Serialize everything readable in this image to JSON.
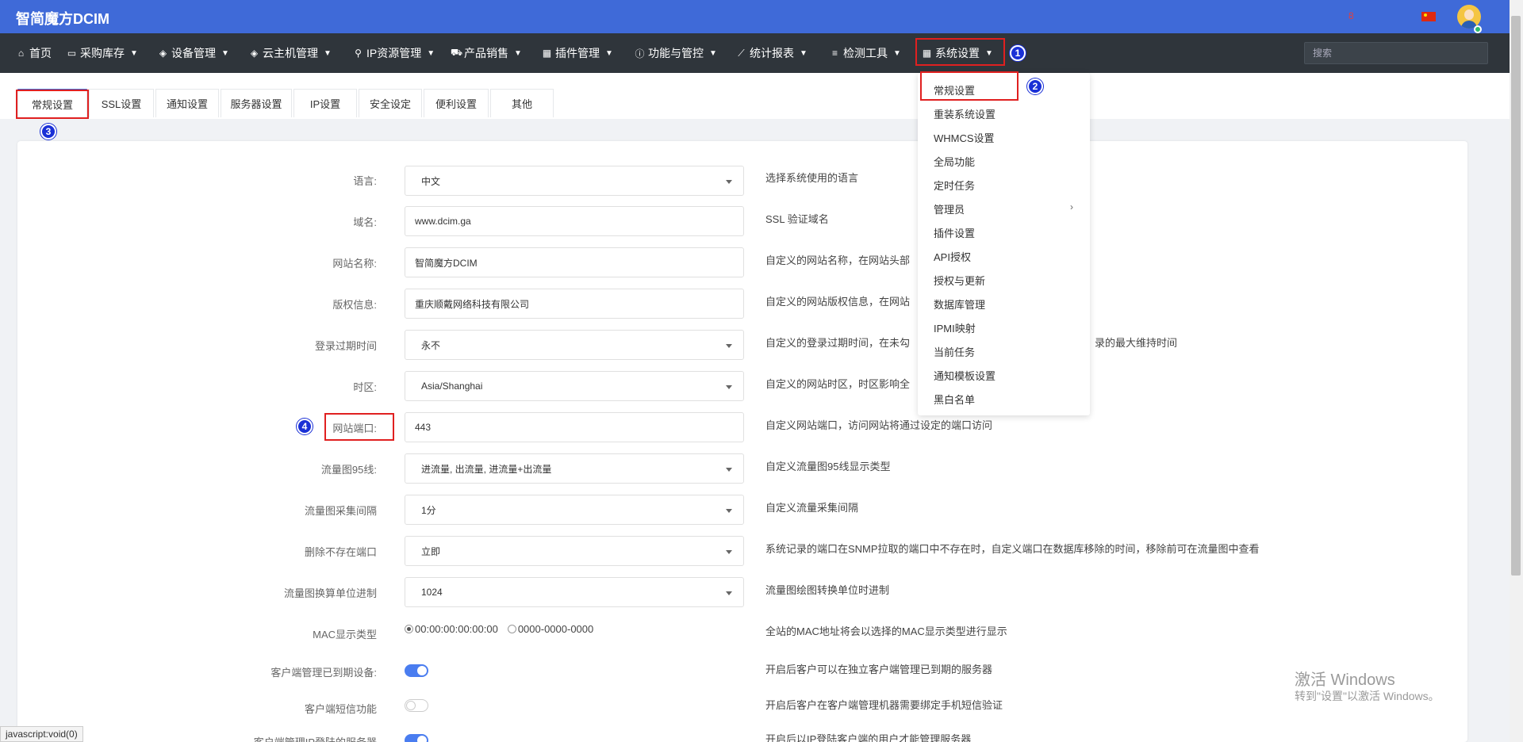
{
  "app": {
    "brand": "智简魔方DCIM",
    "alert_glyph": "8"
  },
  "nav": {
    "items": [
      {
        "label": "首页",
        "icon": "home-icon",
        "glyph": "⌂"
      },
      {
        "label": "采购库存",
        "icon": "cart-icon",
        "glyph": "▭"
      },
      {
        "label": "设备管理",
        "icon": "cube-icon",
        "glyph": "◈"
      },
      {
        "label": "云主机管理",
        "icon": "cube-icon",
        "glyph": "◈"
      },
      {
        "label": "IP资源管理",
        "icon": "map-marker-icon",
        "glyph": "⚲"
      },
      {
        "label": "产品销售",
        "icon": "shopping-cart-icon",
        "glyph": "⛟"
      },
      {
        "label": "插件管理",
        "icon": "grid-icon",
        "glyph": "▦"
      },
      {
        "label": "功能与管控",
        "icon": "info-icon",
        "glyph": "ⓘ"
      },
      {
        "label": "统计报表",
        "icon": "line-chart-icon",
        "glyph": "⟋"
      },
      {
        "label": "检测工具",
        "icon": "list-icon",
        "glyph": "≡"
      },
      {
        "label": "系统设置",
        "icon": "windows-icon",
        "glyph": "▦"
      }
    ],
    "search_placeholder": "搜索"
  },
  "tabs": [
    "常规设置",
    "SSL设置",
    "通知设置",
    "服务器设置",
    "IP设置",
    "安全设定",
    "便利设置",
    "其他"
  ],
  "form": {
    "rows": [
      {
        "label": "语言:",
        "value": "中文",
        "desc": "选择系统使用的语言"
      },
      {
        "label": "域名:",
        "value": "www.dcim.ga",
        "desc": "SSL 验证域名"
      },
      {
        "label": "网站名称:",
        "value": "智简魔方DCIM",
        "desc": "自定义的网站名称，在网站头部"
      },
      {
        "label": "版权信息:",
        "value": "重庆顺戴网络科技有限公司",
        "desc": "自定义的网站版权信息，在网站"
      },
      {
        "label": "登录过期时间",
        "value": "永不",
        "desc": "自定义的登录过期时间，在未勾",
        "desc2": "录的最大维持时间"
      },
      {
        "label": "时区:",
        "value": "Asia/Shanghai",
        "desc": "自定义的网站时区，时区影响全"
      },
      {
        "label": "网站端口:",
        "value": "443",
        "desc": "自定义网站端口，访问网站将通过设定的端口访问"
      },
      {
        "label": "流量图95线:",
        "value": "进流量, 出流量, 进流量+出流量",
        "desc": "自定义流量图95线显示类型"
      },
      {
        "label": "流量图采集间隔",
        "value": "1分",
        "desc": "自定义流量采集间隔"
      },
      {
        "label": "删除不存在端口",
        "value": "立即",
        "desc": "系统记录的端口在SNMP拉取的端口中不存在时，自定义端口在数据库移除的时间，移除前可在流量图中查看"
      },
      {
        "label": "流量图换算单位进制",
        "value": "1024",
        "desc": "流量图绘图转换单位时进制"
      }
    ],
    "mac": {
      "label": "MAC显示类型",
      "option1": "00:00:00:00:00:00",
      "option2": "0000-0000-0000",
      "selected": "00:00:00:00:00:00",
      "desc": "全站的MAC地址将会以选择的MAC显示类型进行显示"
    },
    "toggles": [
      {
        "label": "客户端管理已到期设备:",
        "on": true,
        "desc": "开启后客户可以在独立客户端管理已到期的服务器"
      },
      {
        "label": "客户端短信功能",
        "on": false,
        "desc": "开启后客户在客户端管理机器需要绑定手机短信验证"
      },
      {
        "label": "客户端管理IP登陆的服务器",
        "on": true,
        "desc": "开启后以IP登陆客户端的用户才能管理服务器"
      }
    ]
  },
  "dropdown": {
    "items": [
      "常规设置",
      "重装系统设置",
      "WHMCS设置",
      "全局功能",
      "定时任务",
      "管理员",
      "插件设置",
      "API授权",
      "授权与更新",
      "数据库管理",
      "IPMI映射",
      "当前任务",
      "通知模板设置",
      "黑白名单"
    ],
    "arrow_glyph": "›"
  },
  "steps": [
    "1",
    "2",
    "3",
    "4"
  ],
  "watermark": {
    "line1": "激活 Windows",
    "line2": "转到\"设置\"以激活 Windows。"
  },
  "status_bar": "javascript:void(0)",
  "colors": {
    "brand": "#3f6ad8",
    "nav_bg": "#2f353b",
    "highlight": "#e02020",
    "step": "#1a30d6",
    "toggle_on": "#4a7df0"
  }
}
